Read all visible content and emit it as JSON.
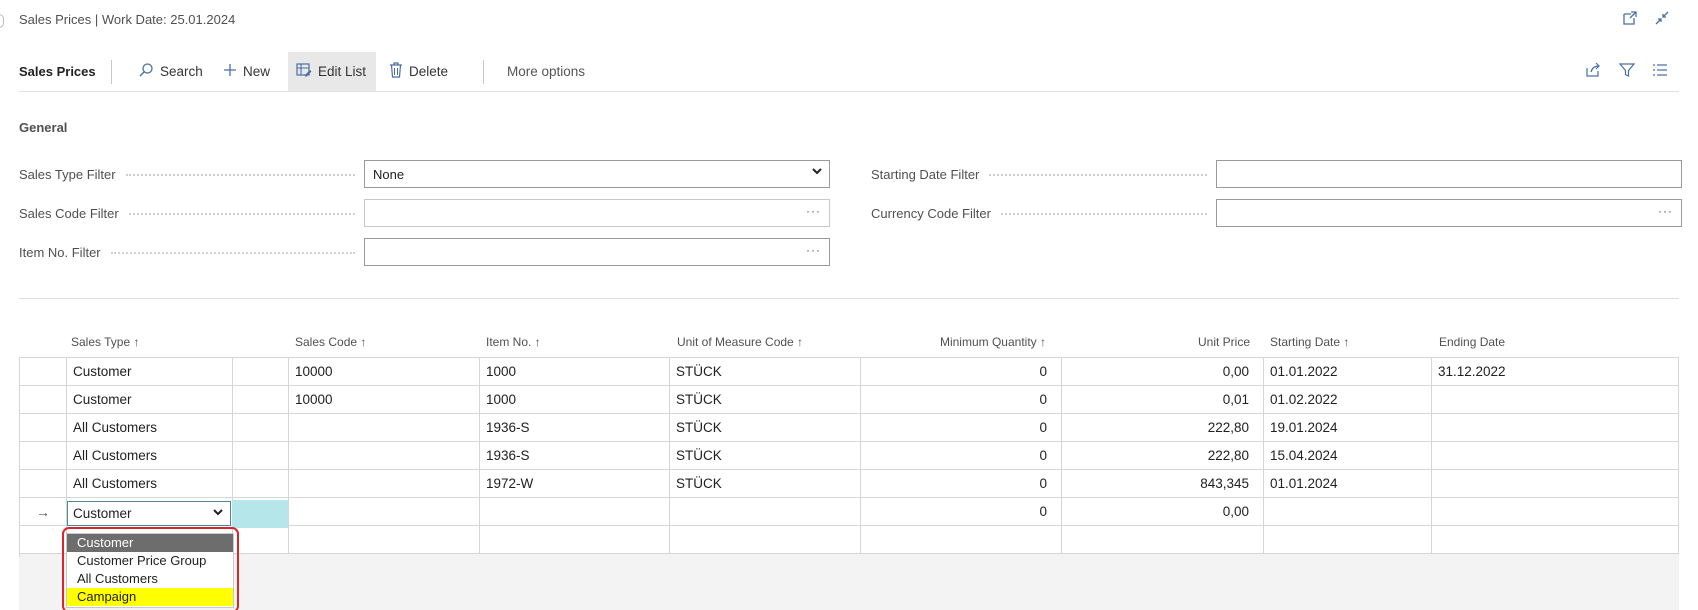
{
  "window": {
    "title": "Sales Prices | Work Date: 25.01.2024",
    "icons": [
      "open-new-window-icon",
      "collapse-icon"
    ]
  },
  "actionbar": {
    "page_name": "Sales Prices",
    "search_label": "Search",
    "new_label": "New",
    "edit_list_label": "Edit List",
    "delete_label": "Delete",
    "more_label": "More options",
    "right_icons": [
      "share-icon",
      "filter-icon",
      "list-view-icon"
    ]
  },
  "general": {
    "title": "General",
    "sales_type_filter": {
      "label": "Sales Type Filter",
      "value": "None"
    },
    "sales_code_filter": {
      "label": "Sales Code Filter",
      "value": ""
    },
    "item_no_filter": {
      "label": "Item No. Filter",
      "value": ""
    },
    "starting_date_filter": {
      "label": "Starting Date Filter",
      "value": ""
    },
    "currency_code_filter": {
      "label": "Currency Code Filter",
      "value": ""
    }
  },
  "grid": {
    "columns": {
      "sales_type": "Sales Type ↑",
      "sales_code": "Sales Code ↑",
      "item_no": "Item No. ↑",
      "uom": "Unit of Measure Code ↑",
      "min_qty": "Minimum Quantity ↑",
      "unit_price": "Unit Price",
      "starting_date": "Starting Date ↑",
      "ending_date": "Ending Date"
    },
    "rows": [
      {
        "sales_type": "Customer",
        "sales_code": "10000",
        "item_no": "1000",
        "uom": "STÜCK",
        "min_qty": "0",
        "unit_price": "0,00",
        "starting_date": "01.01.2022",
        "ending_date": "31.12.2022"
      },
      {
        "sales_type": "Customer",
        "sales_code": "10000",
        "item_no": "1000",
        "uom": "STÜCK",
        "min_qty": "0",
        "unit_price": "0,01",
        "starting_date": "01.02.2022",
        "ending_date": ""
      },
      {
        "sales_type": "All Customers",
        "sales_code": "",
        "item_no": "1936-S",
        "uom": "STÜCK",
        "min_qty": "0",
        "unit_price": "222,80",
        "starting_date": "19.01.2024",
        "ending_date": ""
      },
      {
        "sales_type": "All Customers",
        "sales_code": "",
        "item_no": "1936-S",
        "uom": "STÜCK",
        "min_qty": "0",
        "unit_price": "222,80",
        "starting_date": "15.04.2024",
        "ending_date": ""
      },
      {
        "sales_type": "All Customers",
        "sales_code": "",
        "item_no": "1972-W",
        "uom": "STÜCK",
        "min_qty": "0",
        "unit_price": "843,345",
        "starting_date": "01.01.2024",
        "ending_date": ""
      }
    ],
    "new_row": {
      "arrow": "→",
      "sales_type": "Customer",
      "min_qty": "0",
      "unit_price": "0,00"
    },
    "dropdown_options": [
      "Customer",
      "Customer Price Group",
      "All Customers",
      "Campaign"
    ],
    "dropdown_selected": "Customer",
    "dropdown_highlighted": "Campaign",
    "highlight_color": "#ffff00",
    "callout_color": "#d9262a"
  }
}
